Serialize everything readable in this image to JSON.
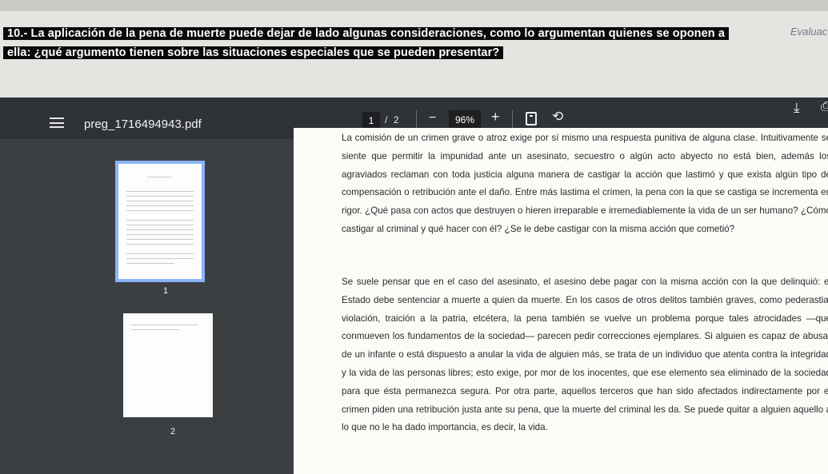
{
  "question": {
    "line1": "10.- La aplicación de la pena de muerte puede dejar de lado algunas consideraciones, como lo argumentan quienes se oponen a",
    "line2": "ella: ¿qué argumento tienen sobre las situaciones especiales que se pueden presentar?",
    "side_label": "Evaluac"
  },
  "viewer": {
    "title": "preg_1716494943.pdf",
    "current_page": "1",
    "separator": "/",
    "total_pages": "2",
    "zoom": "96%",
    "zoom_out_symbol": "−",
    "zoom_in_symbol": "+",
    "rotate_symbol": "⟲",
    "download_symbol": "⤓"
  },
  "thumbnails": [
    {
      "label": "1",
      "selected": true
    },
    {
      "label": "2",
      "selected": false
    }
  ],
  "document": {
    "paragraph1": "La comisión de un crimen grave o atroz exige por sí mismo una respuesta punitiva de alguna clase. Intuitivamente se siente que permitir la impunidad ante un asesinato, secuestro o algún acto abyecto no está bien, además los agraviados reclaman con toda justicia alguna manera de castigar la acción que lastimó y que exista algún tipo de compensación o retribución ante el daño. Entre más lastima el crimen, la pena con la que se castiga se incrementa en rigor. ¿Qué pasa con actos que destruyen o hieren irreparable e irremediablemente la vida de un ser humano? ¿Cómo castigar al criminal y qué hacer con él? ¿Se le debe castigar con la misma acción que cometió?",
    "paragraph2": "Se suele pensar que en el caso del asesinato, el asesino debe pagar con la misma acción con la que delinquió: el Estado debe sentenciar a muerte a quien da muerte. En los casos de otros delitos también graves, como pederastia, violación, traición a la patria, etcétera, la pena también se vuelve un problema porque tales atrocidades —que conmueven los fundamentos de la sociedad— parecen pedir correcciones ejemplares. Si alguien es capaz de abusar de un infante o está dispuesto a anular la vida de alguien más, se trata de un individuo que atenta contra la integridad y la vida de las personas libres; esto exige, por mor de los inocentes, que ese elemento sea eliminado de la sociedad para que ésta permanezca segura. Por otra parte, aquellos terceros que han sido afectados indirectamente por el crimen piden una retribución justa ante su pena, que la muerte del criminal les da. Se puede quitar a alguien aquello a lo que no le ha dado importancia, es decir, la vida."
  },
  "colors": {
    "toolbar": "#2f3236",
    "viewer_bg": "#3c3f42",
    "thumb_selected": "#8ab4f8",
    "question_bg": "#0a0a0a"
  }
}
